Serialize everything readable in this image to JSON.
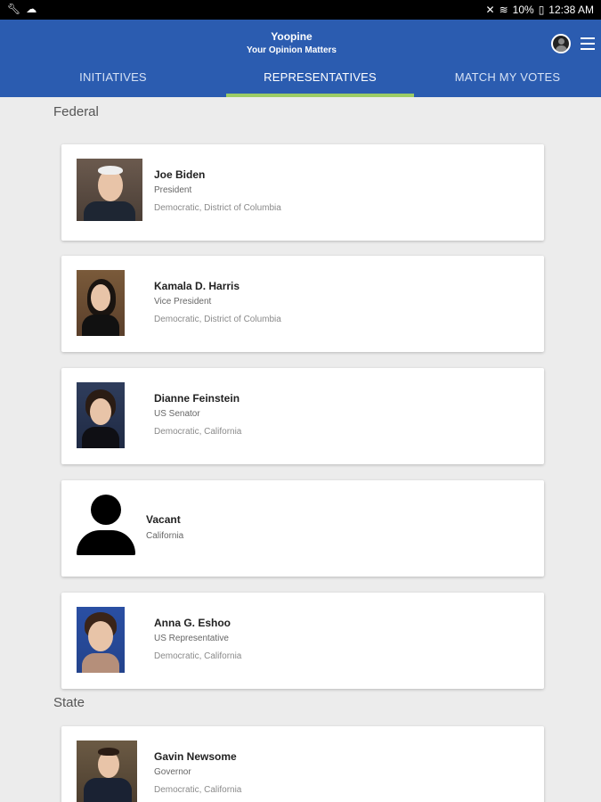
{
  "status_bar": {
    "left_icons": [
      "wrench-icon",
      "cloud-icon"
    ],
    "battery": "10%",
    "time": "12:38 AM"
  },
  "app": {
    "title": "Yoopine",
    "subtitle": "Your Opinion Matters",
    "accent_color": "#2b5cb0",
    "tab_indicator_color": "#9ccc65"
  },
  "tabs": [
    {
      "label": "INITIATIVES",
      "active": false
    },
    {
      "label": "REPRESENTATIVES",
      "active": true
    },
    {
      "label": "MATCH MY VOTES",
      "active": false
    }
  ],
  "sections": [
    {
      "title": "Federal",
      "reps": [
        {
          "name": "Joe Biden",
          "title": "President",
          "party": "Democratic, District of Columbia"
        },
        {
          "name": "Kamala D. Harris",
          "title": "Vice President",
          "party": "Democratic, District of Columbia"
        },
        {
          "name": "Dianne Feinstein",
          "title": "US Senator",
          "party": "Democratic, California"
        },
        {
          "name": "Vacant",
          "title": "California",
          "party": ""
        },
        {
          "name": "Anna G. Eshoo",
          "title": "US Representative",
          "party": "Democratic, California"
        }
      ]
    },
    {
      "title": "State",
      "reps": [
        {
          "name": "Gavin Newsome",
          "title": "Governor",
          "party": "Democratic, California"
        }
      ]
    }
  ]
}
